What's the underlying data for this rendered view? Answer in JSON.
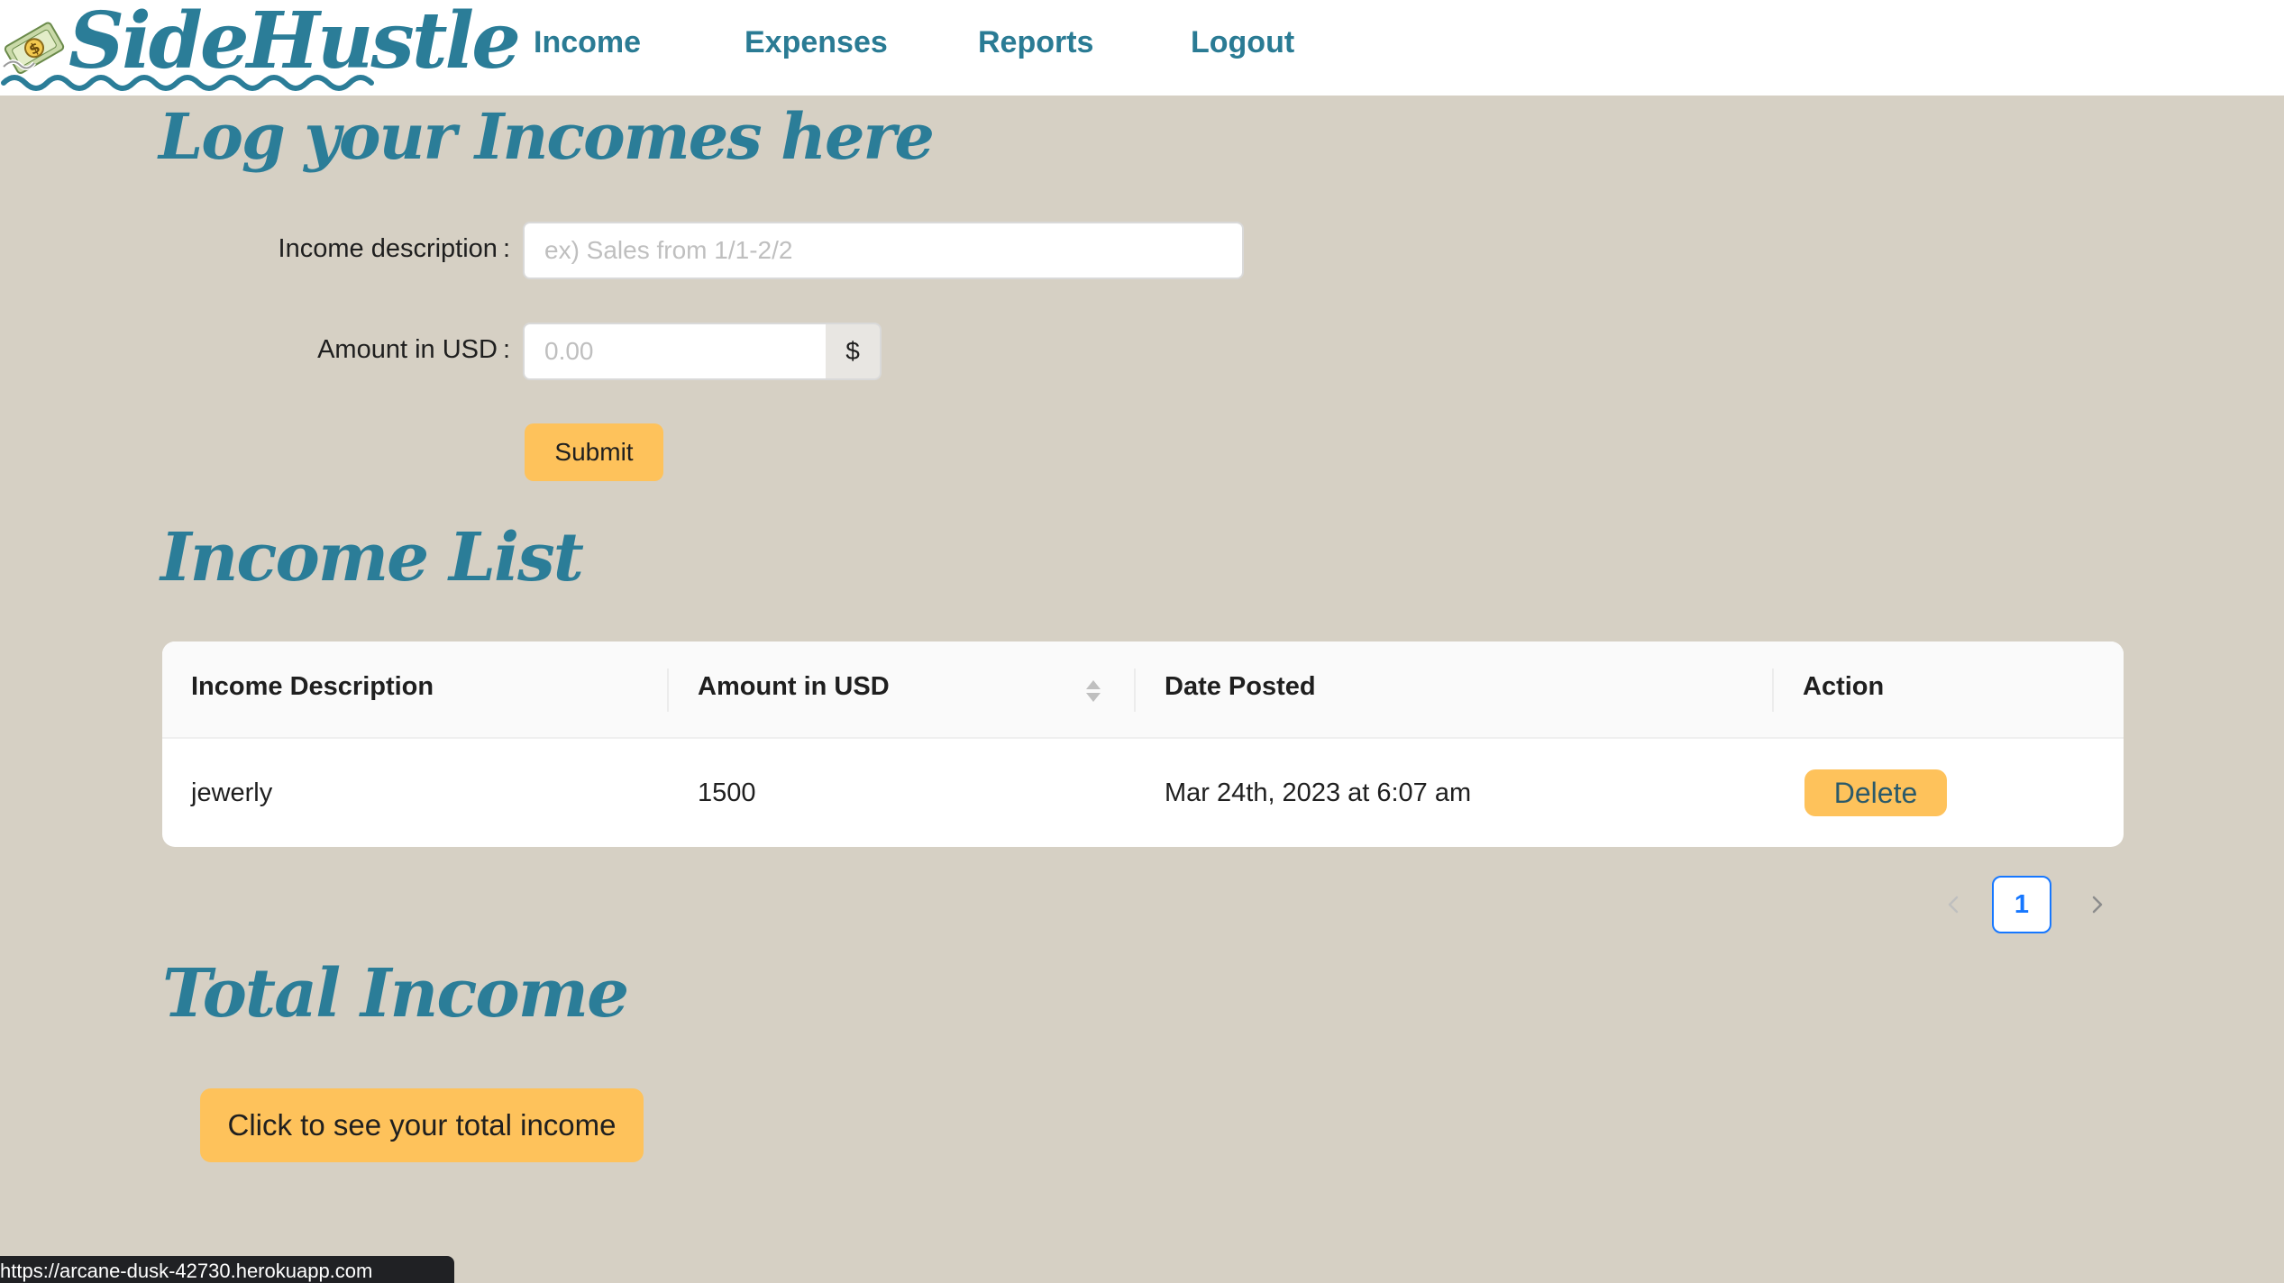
{
  "app": {
    "brand": "SideHustle",
    "nav": [
      {
        "label": "Income"
      },
      {
        "label": "Expenses"
      },
      {
        "label": "Reports"
      },
      {
        "label": "Logout"
      }
    ],
    "colors": {
      "brand": "#2b7d98",
      "accent": "#fec25b",
      "background": "#d6d0c4",
      "pagination": "#1677ff"
    }
  },
  "form": {
    "heading": "Log your Incomes here",
    "description_label": "Income description",
    "description_placeholder": "ex) Sales from 1/1-2/2",
    "description_value": "",
    "amount_label": "Amount in USD",
    "amount_placeholder": "0.00",
    "amount_value": "",
    "currency_addon": "$",
    "submit_label": "Submit",
    "label_colon": ":"
  },
  "income_list": {
    "heading": "Income List",
    "columns": [
      "Income Description",
      "Amount in USD",
      "Date Posted",
      "Action"
    ],
    "sorter_icon": "sort-icon",
    "rows": [
      {
        "description": "jewerly",
        "amount": "1500",
        "date": "Mar 24th, 2023 at 6:07 am",
        "action": "Delete"
      }
    ],
    "pagination": {
      "current_page": "1",
      "prev_icon": "chevron-left-icon",
      "next_icon": "chevron-right-icon"
    }
  },
  "total": {
    "heading": "Total Income",
    "button_label": "Click to see your total income"
  },
  "status_bar": {
    "url": "https://arcane-dusk-42730.herokuapp.com"
  }
}
